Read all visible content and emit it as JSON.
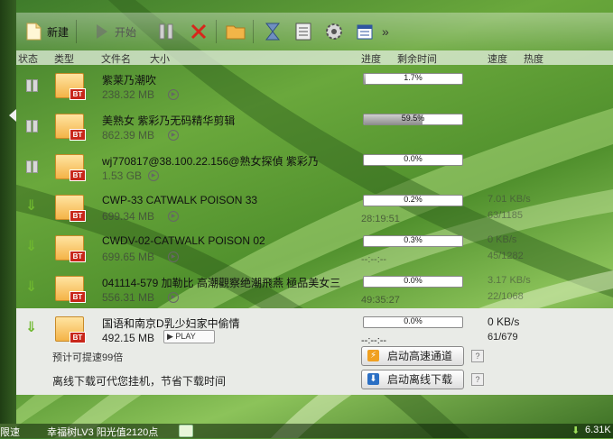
{
  "toolbar": {
    "new_label": "新建",
    "start_label": "开始"
  },
  "columns": {
    "status": "状态",
    "type": "类型",
    "filename": "文件名",
    "size": "大小",
    "progress": "进度",
    "remaining": "剩余时间",
    "speed": "速度",
    "heat": "热度"
  },
  "tasks": [
    {
      "name": "紫莱乃潮吹",
      "size": "238.32 MB",
      "progress_text": "1.7%",
      "progress": 0.017,
      "remaining": "",
      "speed": "",
      "pieces": "",
      "status": "paused",
      "type_tag": "BT"
    },
    {
      "name": "美熟女 紫彩乃无码精华剪辑",
      "size": "862.39 MB",
      "progress_text": "59.5%",
      "progress": 0.595,
      "remaining": "",
      "speed": "",
      "pieces": "",
      "status": "paused",
      "type_tag": "BT"
    },
    {
      "name": "wj770817@38.100.22.156@熟女探偵 紫彩乃",
      "size": "1.53 GB",
      "progress_text": "0.0%",
      "progress": 0.0,
      "remaining": "",
      "speed": "",
      "pieces": "",
      "status": "paused",
      "type_tag": "BT"
    },
    {
      "name": "CWP-33 CATWALK POISON 33",
      "size": "699.34 MB",
      "progress_text": "0.2%",
      "progress": 0.002,
      "remaining": "28:19:51",
      "speed": "7.01 KB/s",
      "pieces": "63/1185",
      "status": "downloading",
      "type_tag": "BT"
    },
    {
      "name": "CWDV-02-CATWALK POISON 02",
      "size": "699.65 MB",
      "progress_text": "0.3%",
      "progress": 0.003,
      "remaining": "--:--:--",
      "speed": "0 KB/s",
      "pieces": "45/1282",
      "status": "downloading",
      "type_tag": "BT"
    },
    {
      "name": "041114-579 加勒比 高潮觀察绝潮飛燕 極品美女三",
      "size": "556.31 MB",
      "progress_text": "0.0%",
      "progress": 0.0,
      "remaining": "49:35:27",
      "speed": "3.17 KB/s",
      "pieces": "22/1068",
      "status": "downloading",
      "type_tag": "BT"
    },
    {
      "name": "国语和南京D乳少妇家中偷情",
      "size": "492.15 MB",
      "progress_text": "0.0%",
      "progress": 0.0,
      "remaining": "--:--:--",
      "speed": "0 KB/s",
      "pieces": "61/679",
      "status": "downloading",
      "type_tag": "BT"
    }
  ],
  "selected": {
    "play_label": "PLAY",
    "accel_tip": "预计可提速99倍",
    "offline_tip": "离线下载可代您挂机，节省下载时间",
    "accel_button": "启动高速通道",
    "offline_button": "启动离线下载",
    "help": "?"
  },
  "statusbar": {
    "left_text": "限速",
    "level_text": "幸福树LV3 阳光值2120点",
    "speed_text": "6.31K"
  },
  "colors": {
    "accent_green": "#6fb82f",
    "bt_tag": "#c8261a",
    "folder": "#f4b347"
  }
}
